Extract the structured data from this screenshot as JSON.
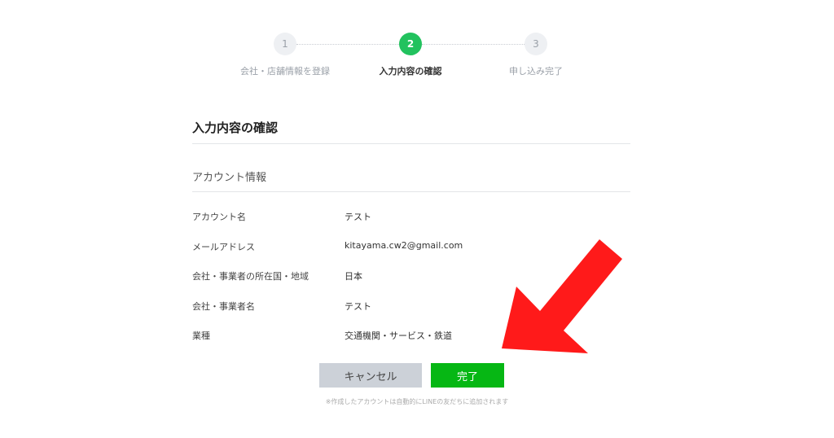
{
  "stepper": {
    "steps": [
      {
        "number": "1",
        "label": "会社・店舗情報を登録",
        "active": false
      },
      {
        "number": "2",
        "label": "入力内容の確認",
        "active": true
      },
      {
        "number": "3",
        "label": "申し込み完了",
        "active": false
      }
    ]
  },
  "main": {
    "title": "入力内容の確認",
    "section_title": "アカウント情報",
    "fields": [
      {
        "label": "アカウント名",
        "value": "テスト"
      },
      {
        "label": "メールアドレス",
        "value": "kitayama.cw2@gmail.com"
      },
      {
        "label": "会社・事業者の所在国・地域",
        "value": "日本"
      },
      {
        "label": "会社・事業者名",
        "value": "テスト"
      },
      {
        "label": "業種",
        "value": "交通機関・サービス・鉄道"
      }
    ]
  },
  "actions": {
    "cancel_label": "キャンセル",
    "done_label": "完了",
    "note": "※作成したアカウントは自動的にLINEの友だちに追加されます"
  },
  "colors": {
    "step_active": "#22c25e",
    "done_button": "#06b714",
    "cancel_button": "#ccd1d8",
    "annotation_arrow": "#ff1a1a"
  },
  "icons": {
    "annotation": "red-arrow-icon"
  }
}
